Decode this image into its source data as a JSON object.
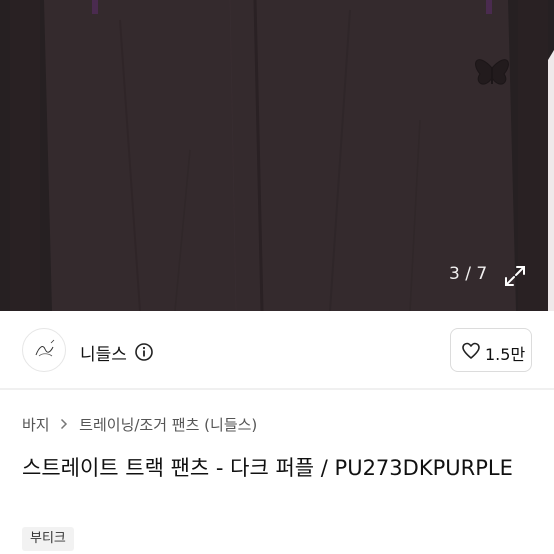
{
  "gallery": {
    "counter": "3 / 7",
    "expand_icon": "expand-arrows-icon"
  },
  "brand": {
    "name": "니들스",
    "info_icon": "info-circle-icon",
    "like_count": "1.5만"
  },
  "breadcrumb": {
    "category": "바지",
    "subcategory": "트레이닝/조거 팬츠 (니들스)"
  },
  "product": {
    "title": "스트레이트 트랙 팬츠 - 다크 퍼플 / PU273DKPURPLE",
    "tag": "부티크"
  },
  "colors": {
    "fabric": "#2f2628",
    "stripe": "#241d1f",
    "accent": "#4a2b4f"
  }
}
